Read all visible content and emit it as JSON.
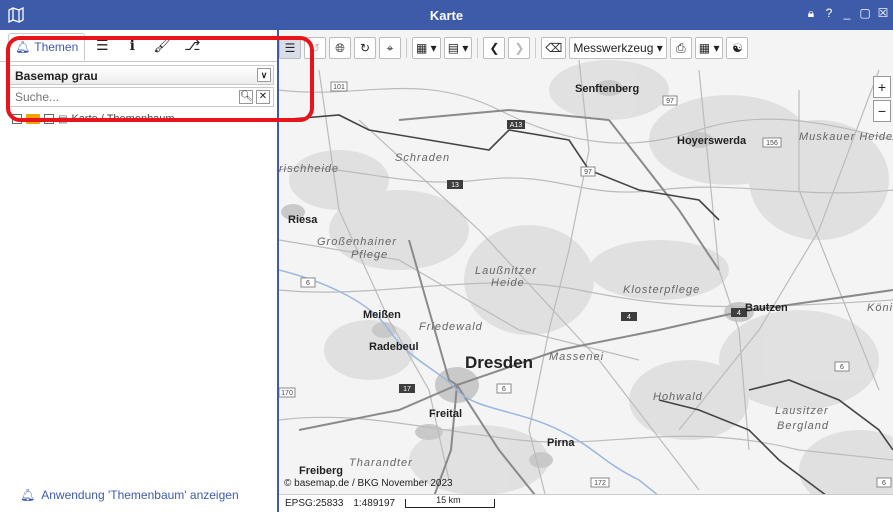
{
  "window": {
    "title": "Karte",
    "controls": [
      "lock-icon",
      "help-icon",
      "minimize-icon",
      "maximize-icon",
      "close-icon"
    ]
  },
  "left_panel": {
    "tabs": [
      {
        "label": "Themen",
        "icon": "bell-icon"
      },
      {
        "icon": "list-icon"
      },
      {
        "icon": "info-icon"
      },
      {
        "icon": "brush-icon"
      },
      {
        "icon": "branch-icon"
      }
    ],
    "basemap_select": "Basemap grau",
    "search_placeholder": "Suche...",
    "tree_item_label": "Karte / Themenbaum",
    "footer_link": "Anwendung 'Themenbaum' anzeigen"
  },
  "toolbar": {
    "measure_label": "Messwerkzeug"
  },
  "map": {
    "labels": {
      "senftenberg": "Senftenberg",
      "hoyerswerda": "Hoyerswerda",
      "muskauer": "Muskauer Heide",
      "schraden": "Schraden",
      "frischheide": "rischheide",
      "riesa": "Riesa",
      "grossenhainer": "Großenhainer",
      "pflege": "Pflege",
      "laussnitzer": "Laußnitzer",
      "heide": "Heide",
      "klosterpflege": "Klosterpflege",
      "bautzen": "Bautzen",
      "koenig": "König",
      "meissen": "Meißen",
      "friedewald": "Friedewald",
      "radebeul": "Radebeul",
      "dresden": "Dresden",
      "massenei": "Massenei",
      "hohwald": "Hohwald",
      "lausitzer": "Lausitzer",
      "bergland": "Bergland",
      "freital": "Freital",
      "pirna": "Pirna",
      "freiberg": "Freiberg",
      "tharandter": "Tharandter"
    },
    "road_numbers": {
      "r101": "101",
      "r97a": "97",
      "a13a": "A13",
      "r156": "156",
      "r97b": "97",
      "a13b": "13",
      "r6a": "6",
      "a4a": "4",
      "a4b": "4",
      "r6b": "6",
      "a17": "17",
      "r6c": "6",
      "r170": "170",
      "r172": "172",
      "r6d": "6"
    }
  },
  "attribution": "© basemap.de / BKG November 2023",
  "status": {
    "epsg": "EPSG:25833",
    "scale": "1:489197",
    "scalebar": "15 km"
  }
}
